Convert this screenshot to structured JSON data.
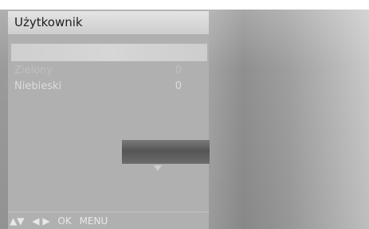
{
  "menu": {
    "title": "Użytkownik",
    "items": [
      {
        "label": "Zielony",
        "value": "0"
      },
      {
        "label": "Niebieski",
        "value": "0"
      }
    ]
  },
  "nav_hint": {
    "up_down": "▲▼",
    "left_right": "◀ ▶",
    "ok": "OK",
    "menu": "MENU"
  }
}
